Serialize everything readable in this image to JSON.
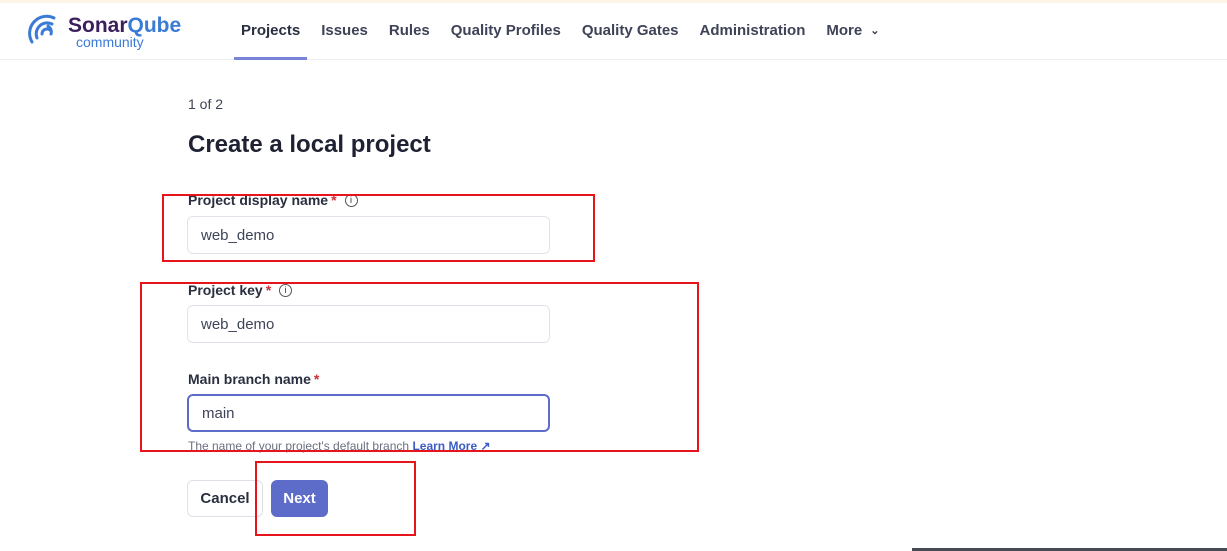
{
  "header": {
    "brand_main": "Sonar",
    "brand_accent": "Qube",
    "brand_sub": "community",
    "nav": [
      "Projects",
      "Issues",
      "Rules",
      "Quality Profiles",
      "Quality Gates",
      "Administration",
      "More"
    ]
  },
  "form": {
    "step": "1 of 2",
    "title": "Create a local project",
    "display_name_label": "Project display name",
    "display_name_value": "web_demo",
    "key_label": "Project key",
    "key_value": "web_demo",
    "branch_label": "Main branch name",
    "branch_value": "main",
    "required_mark": "*",
    "help_text": "The name of your project's default branch",
    "learn_more": "Learn More",
    "cancel": "Cancel",
    "next": "Next"
  },
  "colors": {
    "accent": "#5d6cc9",
    "annotation": "#e8141b"
  }
}
